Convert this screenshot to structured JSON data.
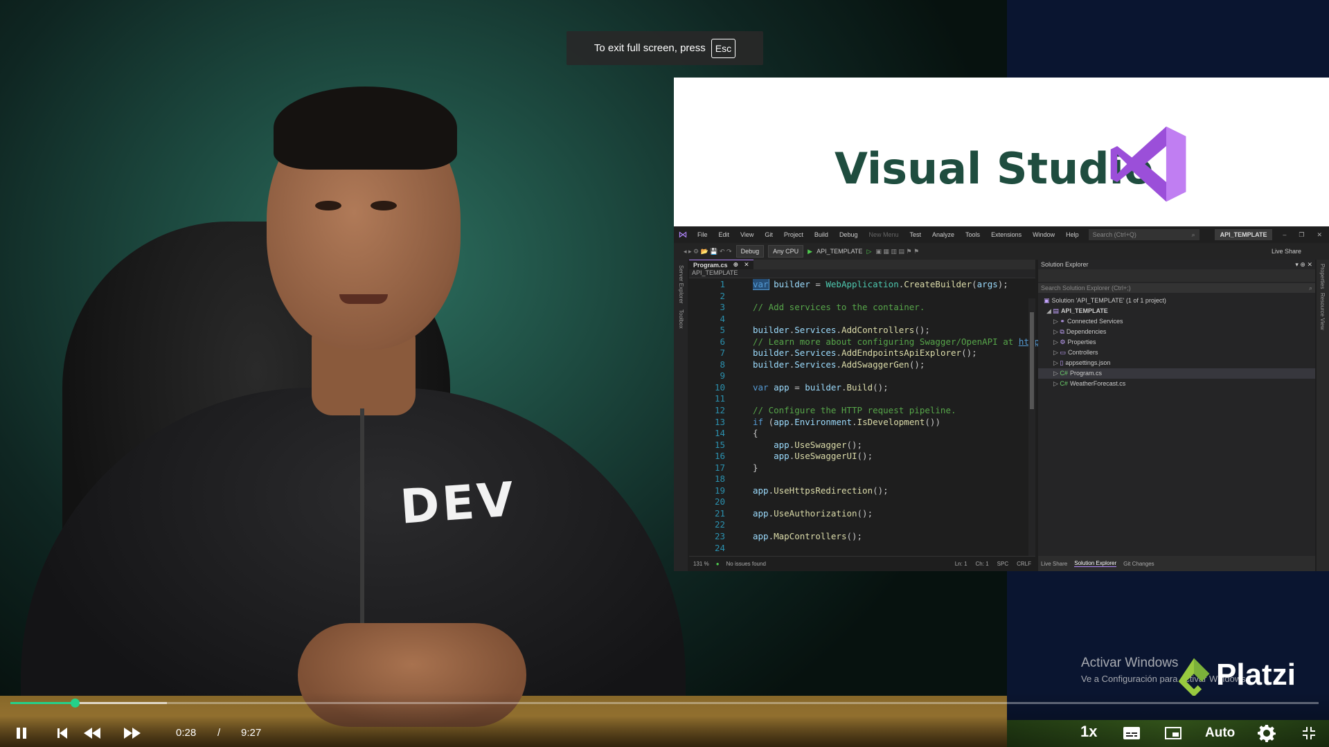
{
  "fullscreen_notice": {
    "text": "To exit full screen, press",
    "key": "Esc"
  },
  "slide": {
    "title": "Visual Studio",
    "ide": {
      "menu": [
        "File",
        "Edit",
        "View",
        "Git",
        "Project",
        "Build",
        "Debug",
        "New Menu",
        "Test",
        "Analyze",
        "Tools",
        "Extensions",
        "Window",
        "Help"
      ],
      "search_placeholder": "Search (Ctrl+Q)",
      "solution_name": "API_TEMPLATE",
      "toolbar": {
        "config": "Debug",
        "platform": "Any CPU",
        "run_target": "API_TEMPLATE",
        "live_share": "Live Share"
      },
      "side_panels": [
        "Server Explorer",
        "Toolbox"
      ],
      "right_panels": [
        "Properties",
        "Resource View"
      ],
      "editor": {
        "tab": "Program.cs",
        "nav": "API_TEMPLATE",
        "line_numbers": [
          "1",
          "2",
          "3",
          "4",
          "5",
          "6",
          "7",
          "8",
          "9",
          "10",
          "11",
          "12",
          "13",
          "14",
          "15",
          "16",
          "17",
          "18",
          "19",
          "20",
          "21",
          "22",
          "23",
          "24"
        ],
        "status": {
          "zoom": "131 %",
          "issues": "No issues found",
          "ln": "Ln: 1",
          "ch": "Ch: 1",
          "spc": "SPC",
          "crlf": "CRLF"
        }
      },
      "solution_explorer": {
        "title": "Solution Explorer",
        "search_placeholder": "Search Solution Explorer (Ctrl+;)",
        "nodes": [
          "Solution 'API_TEMPLATE' (1 of 1 project)",
          "API_TEMPLATE",
          "Connected Services",
          "Dependencies",
          "Properties",
          "Controllers",
          "appsettings.json",
          "Program.cs",
          "WeatherForecast.cs"
        ],
        "bottom_tabs": [
          "Live Share",
          "Solution Explorer",
          "Git Changes"
        ]
      }
    }
  },
  "watermark": {
    "line1": "Activar Windows",
    "line2": "Ve a Configuración para activar Windows."
  },
  "brand": "Platzi",
  "person_shirt_logo": "DEV",
  "player": {
    "current_time": "0:28",
    "separator": "/",
    "duration": "9:27",
    "progress_fraction": 0.0494,
    "buffered_fraction": 0.1195,
    "speed": "1x",
    "quality": "Auto",
    "accent_color": "#24d28a"
  }
}
